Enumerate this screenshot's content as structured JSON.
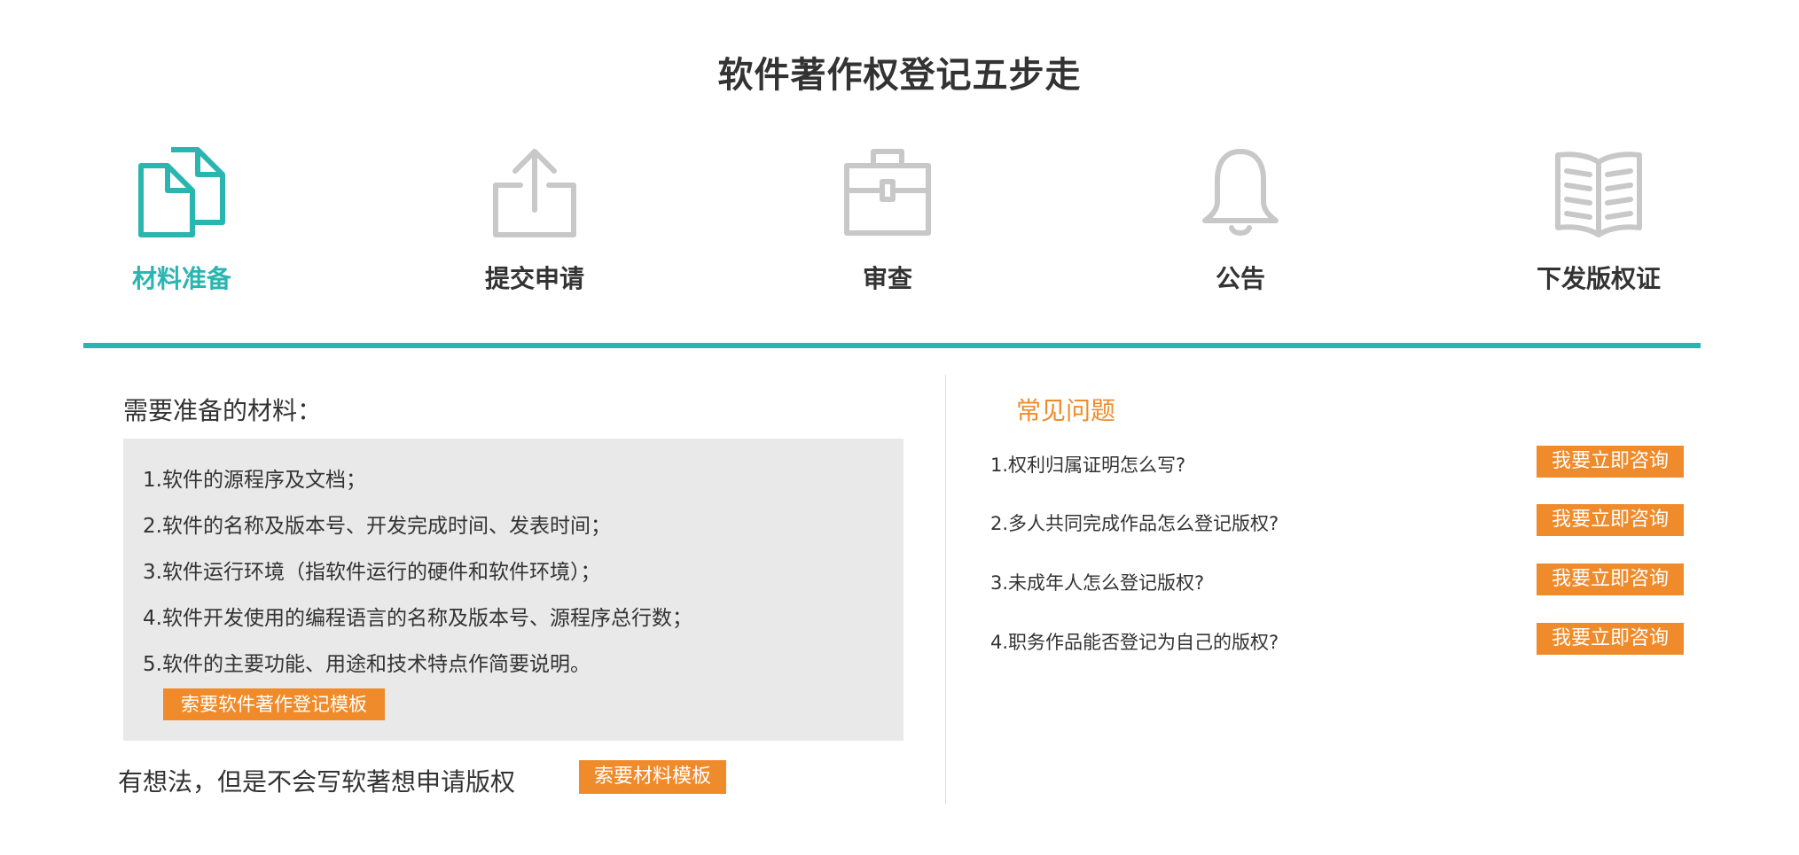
{
  "page": {
    "title": "软件著作权登记五步走"
  },
  "steps": [
    {
      "label": "材料准备",
      "icon": "documents-icon",
      "active": true
    },
    {
      "label": "提交申请",
      "icon": "upload-icon",
      "active": false
    },
    {
      "label": "审查",
      "icon": "briefcase-icon",
      "active": false
    },
    {
      "label": "公告",
      "icon": "bell-icon",
      "active": false
    },
    {
      "label": "下发版权证",
      "icon": "book-icon",
      "active": false
    }
  ],
  "colors": {
    "accent": "#2bb5b0",
    "orange": "#f08b2b",
    "inactive_icon": "#c8c8c8",
    "box_bg": "#e9e9e9"
  },
  "materials": {
    "heading": "需要准备的材料：",
    "items": [
      "1.软件的源程序及文档；",
      "2.软件的名称及版本号、开发完成时间、发表时间；",
      "3.软件运行环境（指软件运行的硬件和软件环境）；",
      "4.软件开发使用的编程语言的名称及版本号、源程序总行数；",
      "5.软件的主要功能、用途和技术特点作简要说明。"
    ],
    "template_button": "索要软件著作登记模板"
  },
  "idea": {
    "text": "有想法，但是不会写软著想申请版权",
    "button": "索要材料模板"
  },
  "faq": {
    "title": "常见问题",
    "button_label": "我要立即咨询",
    "questions": [
      "1.权利归属证明怎么写?",
      "2.多人共同完成作品怎么登记版权?",
      "3.未成年人怎么登记版权?",
      "4.职务作品能否登记为自己的版权?"
    ]
  }
}
